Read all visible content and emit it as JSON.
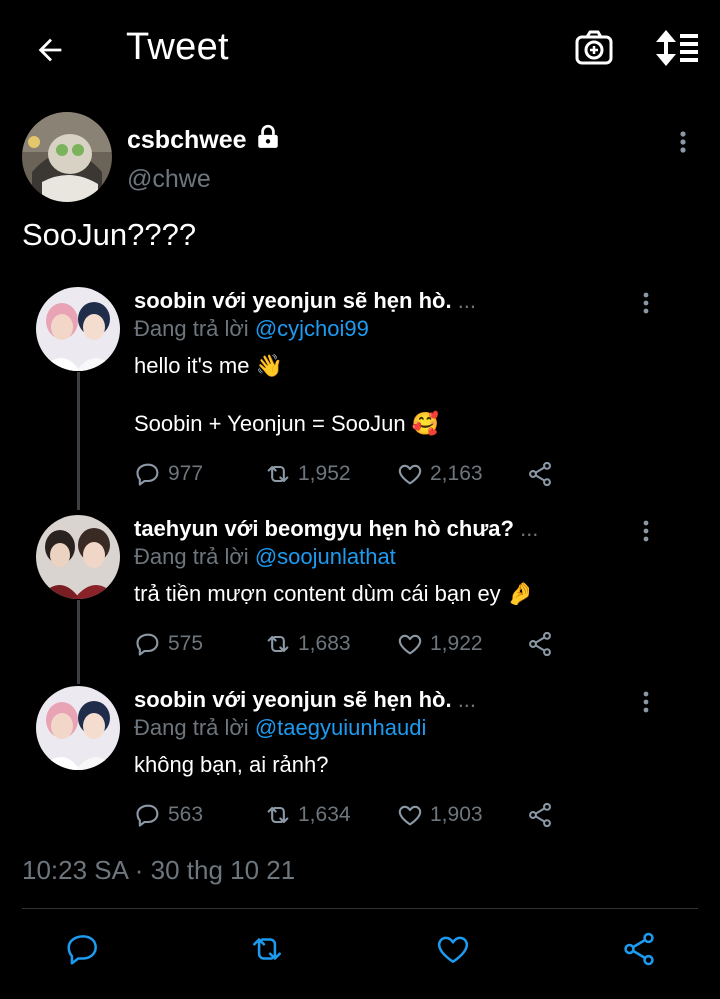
{
  "header": {
    "title": "Tweet",
    "back_icon": "arrow-left-icon",
    "camera_icon": "camera-icon",
    "sort_icon": "sort-icon"
  },
  "tweet": {
    "display_name": "csbchwee",
    "handle": "@chwe",
    "text": "SooJun????",
    "locked": true,
    "timestamp": "10:23 SA · 30 thg 10 21"
  },
  "quotes": [
    {
      "name": "soobin với yeonjun sẽ hẹn hò.",
      "ellipsis": "...",
      "reply_prefix": "Đang trả lời ",
      "mention": "@cyjchoi99",
      "lines": [
        "hello it's me 👋",
        "Soobin + Yeonjun = SooJun 🥰"
      ],
      "replies": "977",
      "retweets": "1,952",
      "likes": "2,163"
    },
    {
      "name": "taehyun với beomgyu hẹn hò chưa?",
      "ellipsis": "...",
      "reply_prefix": "Đang trả lời ",
      "mention": "@soojunlathat",
      "lines": [
        "trả tiền mượn content dùm cái bạn ey 🤌"
      ],
      "replies": "575",
      "retweets": "1,683",
      "likes": "1,922"
    },
    {
      "name": "soobin với yeonjun sẽ hẹn hò.",
      "ellipsis": "...",
      "reply_prefix": "Đang trả lời ",
      "mention": "@taegyuiunhaudi",
      "lines": [
        "không bạn, ai rảnh?"
      ],
      "replies": "563",
      "retweets": "1,634",
      "likes": "1,903"
    }
  ],
  "colors": {
    "background": "#000000",
    "text": "#ffffff",
    "muted": "#6e767d",
    "mention": "#1d9bf0"
  }
}
